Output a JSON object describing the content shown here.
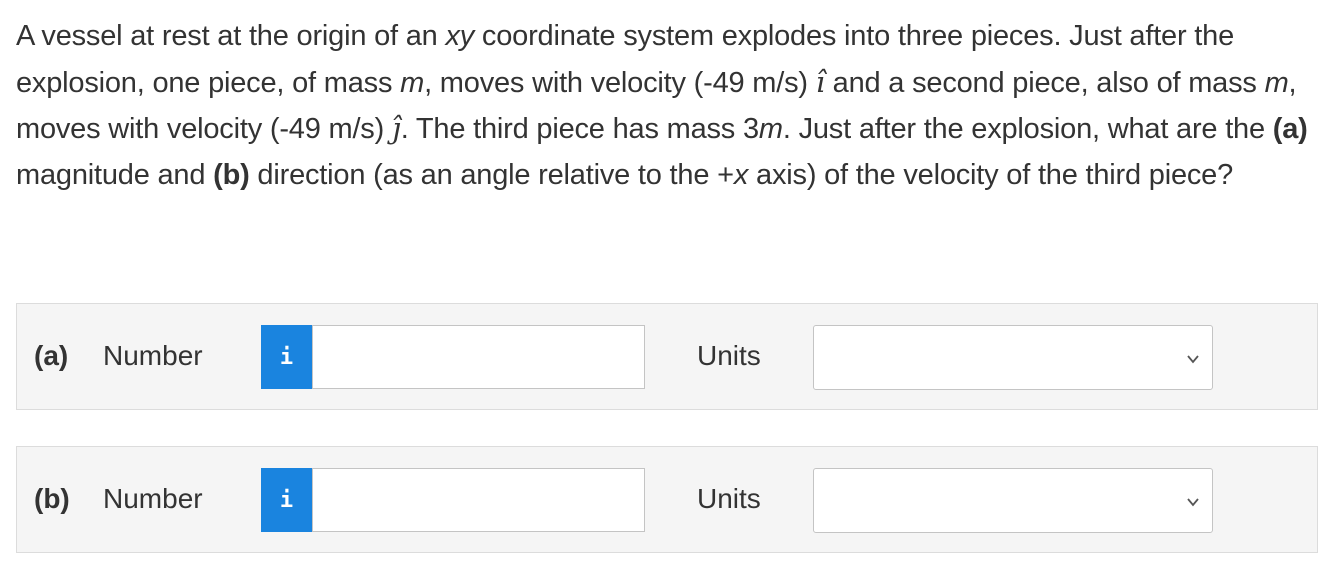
{
  "question": {
    "t1": "A vessel at rest at the origin of an ",
    "t2": "xy",
    "t3": " coordinate system explodes into three pieces. Just after the explosion, one piece, of mass ",
    "t4": "m",
    "t5": ", moves with velocity (-49 m/s) ",
    "t6": "î",
    "t7": " and a second piece, also of mass ",
    "t8": "m",
    "t9": ", moves with velocity (-49 m/s) ",
    "t10": "ĵ",
    "t11": ". The third piece has mass 3",
    "t12": "m",
    "t13": ". Just after the explosion, what are the ",
    "t14": "(a)",
    "t15": " magnitude and ",
    "t16": "(b)",
    "t17": " direction (as an angle relative to the +",
    "t18": "x",
    "t19": " axis) of the velocity of the third piece?"
  },
  "parts": {
    "a": {
      "label": "(a)",
      "number_label": "Number",
      "info_icon": "i",
      "number_value": "",
      "units_label": "Units",
      "units_selected": ""
    },
    "b": {
      "label": "(b)",
      "number_label": "Number",
      "info_icon": "i",
      "number_value": "",
      "units_label": "Units",
      "units_selected": ""
    }
  },
  "colors": {
    "info_button": "#1a84df",
    "row_background": "#f5f5f5",
    "text": "#333333"
  }
}
